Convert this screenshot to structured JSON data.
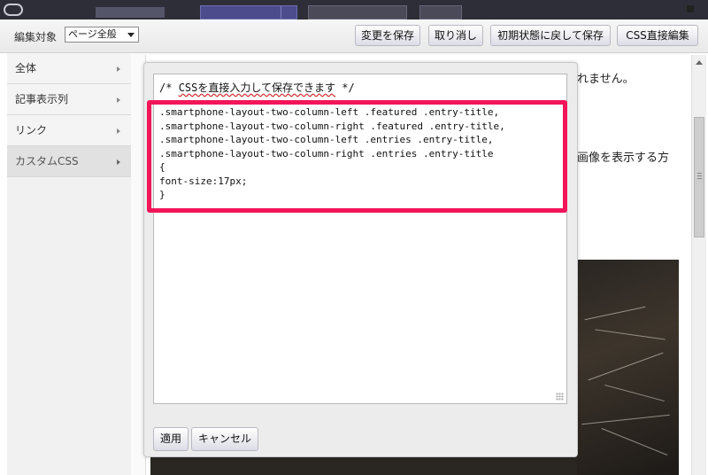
{
  "toolbar": {
    "target_label": "編集対象",
    "target_select": "ページ全般",
    "buttons": {
      "save": "変更を保存",
      "cancel": "取り消し",
      "reset": "初期状態に戻して保存",
      "css_direct": "CSS直接編集"
    }
  },
  "sidebar": {
    "items": [
      {
        "label": "全体"
      },
      {
        "label": "記事表示列"
      },
      {
        "label": "リンク"
      },
      {
        "label": "カスタムCSS"
      }
    ]
  },
  "background_page": {
    "text_1": "れません。",
    "text_2": "画像を表示する方"
  },
  "editor": {
    "comment_prefix": "/* ",
    "comment_underlined": "CSSを直接入力して保存できます",
    "comment_suffix": " */",
    "lines": [
      ".smartphone-layout-two-column-left .featured .entry-title,",
      ".smartphone-layout-two-column-right .featured .entry-title,",
      ".smartphone-layout-two-column-left .entries .entry-title,",
      ".smartphone-layout-two-column-right .entries .entry-title",
      "{",
      "font-size:17px;",
      "}"
    ]
  },
  "panel_buttons": {
    "apply": "適用",
    "cancel": "キャンセル"
  },
  "colors": {
    "highlight": "#f2155a",
    "topbar": "#2e2e38"
  }
}
